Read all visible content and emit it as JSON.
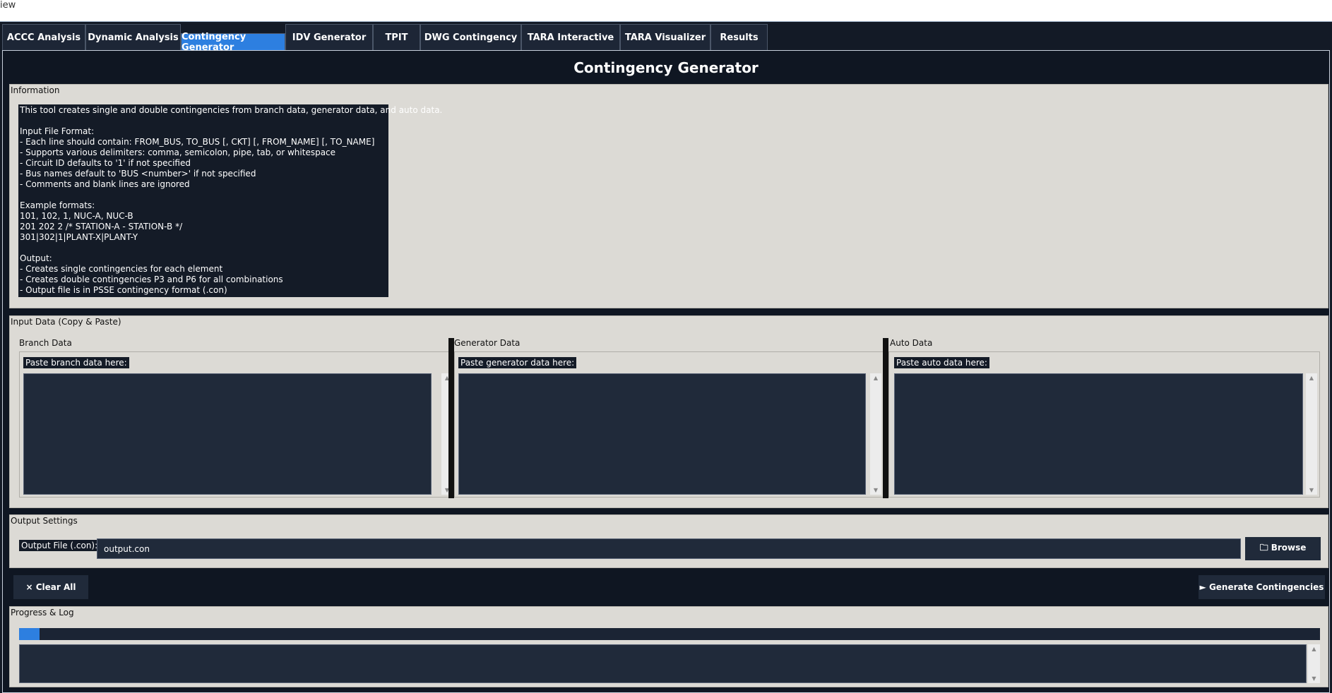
{
  "window": {
    "title_fragment": "iew"
  },
  "tabs": [
    {
      "label": "ACCC Analysis"
    },
    {
      "label": "Dynamic Analysis"
    },
    {
      "label": "Contingency Generator"
    },
    {
      "label": "IDV Generator"
    },
    {
      "label": "TPIT"
    },
    {
      "label": "DWG Contingency"
    },
    {
      "label": "TARA Interactive"
    },
    {
      "label": "TARA Visualizer"
    },
    {
      "label": "Results"
    }
  ],
  "active_tab": "Contingency Generator",
  "page_title": "Contingency Generator",
  "information": {
    "title": "Information",
    "lines": [
      "This tool creates single and double contingencies from branch data, generator data, and auto data.",
      "",
      "Input File Format:",
      "- Each line should contain: FROM_BUS, TO_BUS [, CKT] [, FROM_NAME] [, TO_NAME]",
      "- Supports various delimiters: comma, semicolon, pipe, tab, or whitespace",
      "- Circuit ID defaults to '1' if not specified",
      "- Bus names default to 'BUS <number>' if not specified",
      "- Comments and blank lines are ignored",
      "",
      "Example formats:",
      "101, 102, 1, NUC-A, NUC-B",
      "201 202 2 /* STATION-A - STATION-B */",
      "301|302|1|PLANT-X|PLANT-Y",
      "",
      "Output:",
      "- Creates single contingencies for each element",
      "- Creates double contingencies P3 and P6 for all combinations",
      "- Output file is in PSSE contingency format (.con)"
    ]
  },
  "input_data": {
    "title": "Input Data (Copy & Paste)",
    "branch": {
      "label": "Branch Data",
      "prompt": "Paste branch data here:",
      "value": ""
    },
    "generator": {
      "label": "Generator Data",
      "prompt": "Paste generator data here:",
      "value": ""
    },
    "auto": {
      "label": "Auto Data",
      "prompt": "Paste auto data here:",
      "value": ""
    }
  },
  "output_settings": {
    "title": "Output Settings",
    "file_label": "Output File (.con):",
    "file_value": "output.con",
    "browse_label": "🗀 Browse"
  },
  "actions": {
    "clear_label": "× Clear All",
    "generate_label": "► Generate Contingencies"
  },
  "progress": {
    "title": "Progress & Log",
    "fraction": 0.016,
    "log": ""
  },
  "colors": {
    "accent": "#2d7fe0",
    "background": "#131a26",
    "panel": "#dcdad5",
    "field": "#202a3a"
  }
}
